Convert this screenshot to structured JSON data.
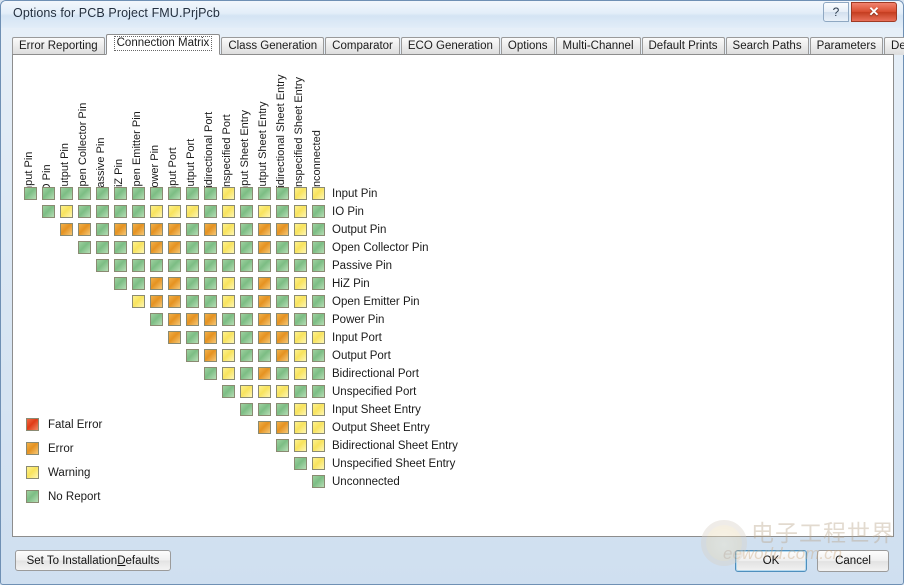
{
  "window": {
    "title": "Options for PCB Project FMU.PrjPcb",
    "help_button": "?",
    "close_button": "✕"
  },
  "tabs": [
    {
      "label": "Error Reporting",
      "active": false
    },
    {
      "label": "Connection Matrix",
      "active": true
    },
    {
      "label": "Class Generation",
      "active": false
    },
    {
      "label": "Comparator",
      "active": false
    },
    {
      "label": "ECO Generation",
      "active": false
    },
    {
      "label": "Options",
      "active": false
    },
    {
      "label": "Multi-Channel",
      "active": false
    },
    {
      "label": "Default Prints",
      "active": false
    },
    {
      "label": "Search Paths",
      "active": false
    },
    {
      "label": "Parameters",
      "active": false
    },
    {
      "label": "Device Sheets",
      "active": false
    }
  ],
  "matrix": {
    "columns": [
      "Input Pin",
      "IO Pin",
      "Output Pin",
      "Open Collector Pin",
      "Passive Pin",
      "HiZ Pin",
      "Open Emitter Pin",
      "Power Pin",
      "Input Port",
      "Output Port",
      "Bidirectional Port",
      "Unspecified Port",
      "Input Sheet Entry",
      "Output Sheet Entry",
      "Bidirectional Sheet Entry",
      "Unspecified Sheet Entry",
      "Unconnected"
    ],
    "rows": [
      "Input Pin",
      "IO Pin",
      "Output Pin",
      "Open Collector Pin",
      "Passive Pin",
      "HiZ Pin",
      "Open Emitter Pin",
      "Power Pin",
      "Input Port",
      "Output Port",
      "Bidirectional Port",
      "Unspecified Port",
      "Input Sheet Entry",
      "Output Sheet Entry",
      "Bidirectional Sheet Entry",
      "Unspecified Sheet Entry",
      "Unconnected"
    ],
    "cells": [
      [
        "green",
        "green",
        "green",
        "green",
        "green",
        "green",
        "green",
        "green",
        "green",
        "green",
        "green",
        "yellow",
        "green",
        "green",
        "green",
        "yellow",
        "yellow"
      ],
      [
        null,
        "green",
        "yellow",
        "green",
        "green",
        "green",
        "green",
        "yellow",
        "yellow",
        "yellow",
        "green",
        "yellow",
        "green",
        "yellow",
        "green",
        "yellow",
        "green"
      ],
      [
        null,
        null,
        "orange",
        "orange",
        "green",
        "orange",
        "orange",
        "orange",
        "orange",
        "green",
        "orange",
        "yellow",
        "green",
        "orange",
        "orange",
        "yellow",
        "green"
      ],
      [
        null,
        null,
        null,
        "green",
        "green",
        "green",
        "yellow",
        "orange",
        "orange",
        "green",
        "green",
        "yellow",
        "green",
        "orange",
        "green",
        "yellow",
        "green"
      ],
      [
        null,
        null,
        null,
        null,
        "green",
        "green",
        "green",
        "green",
        "green",
        "green",
        "green",
        "green",
        "green",
        "green",
        "green",
        "green",
        "green"
      ],
      [
        null,
        null,
        null,
        null,
        null,
        "green",
        "green",
        "orange",
        "orange",
        "green",
        "green",
        "yellow",
        "green",
        "orange",
        "green",
        "yellow",
        "green"
      ],
      [
        null,
        null,
        null,
        null,
        null,
        null,
        "yellow",
        "orange",
        "orange",
        "green",
        "green",
        "yellow",
        "green",
        "orange",
        "green",
        "yellow",
        "green"
      ],
      [
        null,
        null,
        null,
        null,
        null,
        null,
        null,
        "green",
        "orange",
        "orange",
        "orange",
        "green",
        "green",
        "orange",
        "orange",
        "green",
        "green"
      ],
      [
        null,
        null,
        null,
        null,
        null,
        null,
        null,
        null,
        "orange",
        "green",
        "orange",
        "yellow",
        "green",
        "orange",
        "orange",
        "yellow",
        "yellow"
      ],
      [
        null,
        null,
        null,
        null,
        null,
        null,
        null,
        null,
        null,
        "green",
        "orange",
        "yellow",
        "green",
        "green",
        "orange",
        "yellow",
        "green"
      ],
      [
        null,
        null,
        null,
        null,
        null,
        null,
        null,
        null,
        null,
        null,
        "green",
        "yellow",
        "green",
        "orange",
        "green",
        "yellow",
        "green"
      ],
      [
        null,
        null,
        null,
        null,
        null,
        null,
        null,
        null,
        null,
        null,
        null,
        "green",
        "yellow",
        "yellow",
        "yellow",
        "green",
        "green"
      ],
      [
        null,
        null,
        null,
        null,
        null,
        null,
        null,
        null,
        null,
        null,
        null,
        null,
        "green",
        "green",
        "green",
        "yellow",
        "yellow"
      ],
      [
        null,
        null,
        null,
        null,
        null,
        null,
        null,
        null,
        null,
        null,
        null,
        null,
        null,
        "orange",
        "orange",
        "yellow",
        "yellow"
      ],
      [
        null,
        null,
        null,
        null,
        null,
        null,
        null,
        null,
        null,
        null,
        null,
        null,
        null,
        null,
        "green",
        "yellow",
        "yellow"
      ],
      [
        null,
        null,
        null,
        null,
        null,
        null,
        null,
        null,
        null,
        null,
        null,
        null,
        null,
        null,
        null,
        "green",
        "yellow"
      ],
      [
        null,
        null,
        null,
        null,
        null,
        null,
        null,
        null,
        null,
        null,
        null,
        null,
        null,
        null,
        null,
        null,
        "green"
      ]
    ]
  },
  "legend": [
    {
      "label": "Fatal Error",
      "color_key": "red",
      "color": "#e03c16"
    },
    {
      "label": "Error",
      "color_key": "orange",
      "color": "#e59221"
    },
    {
      "label": "Warning",
      "color_key": "yellow",
      "color": "#f8e35d"
    },
    {
      "label": "No Report",
      "color_key": "green",
      "color": "#7cbd84"
    }
  ],
  "buttons": {
    "defaults_pre": "Set To Installation ",
    "defaults_underline": "D",
    "defaults_post": "efaults",
    "ok": "OK",
    "cancel": "Cancel"
  },
  "watermark": {
    "cn": "电子工程世界",
    "en": "eeworld.com.cn"
  }
}
